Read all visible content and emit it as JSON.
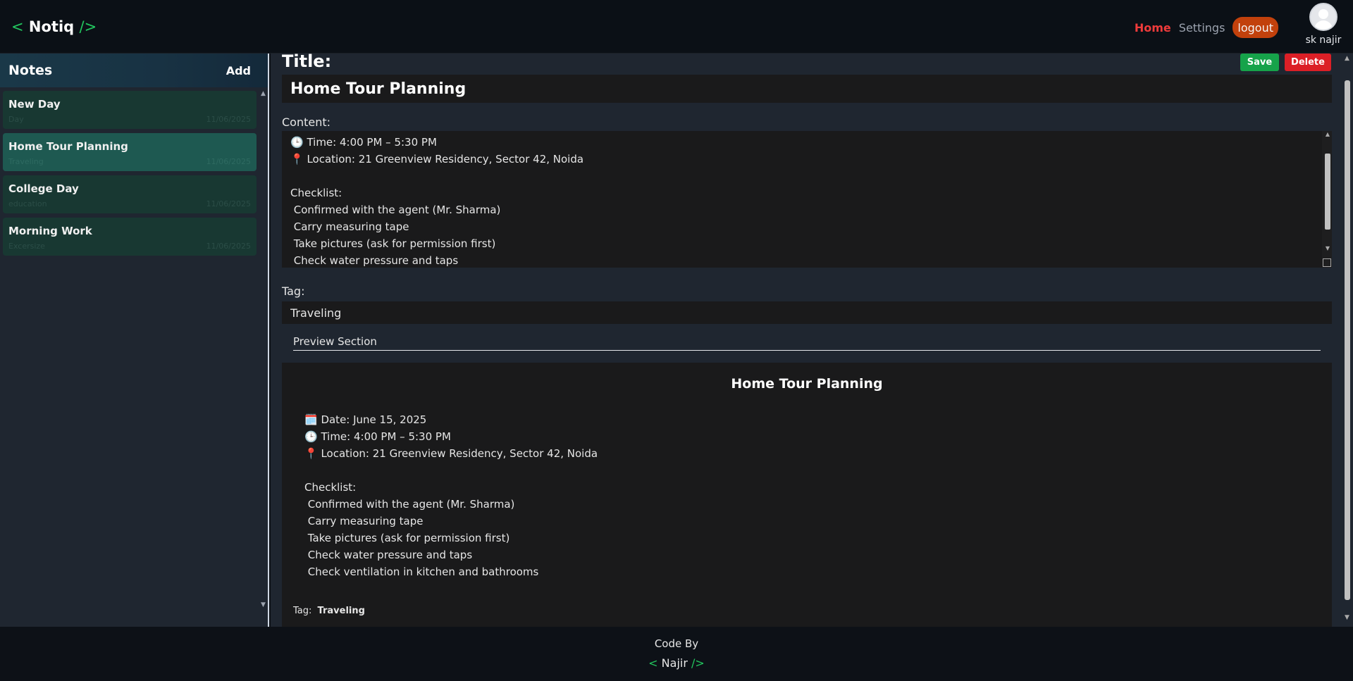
{
  "header": {
    "logo_open": "<",
    "logo_text": "Notiq",
    "logo_close": "/>",
    "nav_home": "Home",
    "nav_settings": "Settings",
    "logout_label": "logout",
    "user_name": "sk najir"
  },
  "sidebar": {
    "title": "Notes",
    "add_label": "Add",
    "notes": [
      {
        "title": "New Day",
        "tag": "Day",
        "date": "11/06/2025"
      },
      {
        "title": "Home Tour Planning",
        "tag": "Traveling",
        "date": "11/06/2025"
      },
      {
        "title": "College Day",
        "tag": "education",
        "date": "11/06/2025"
      },
      {
        "title": "Morning Work",
        "tag": "Excersize",
        "date": "11/06/2025"
      }
    ]
  },
  "editor": {
    "title_label": "Title:",
    "save_label": "Save",
    "delete_label": "Delete",
    "title_value": "Home Tour Planning",
    "content_label": "Content:",
    "content_lines": [
      "🕒 Time: 4:00 PM – 5:30 PM",
      "📍 Location: 21 Greenview Residency, Sector 42, Noida",
      "",
      "Checklist:",
      " Confirmed with the agent (Mr. Sharma)",
      " Carry measuring tape",
      " Take pictures (ask for permission first)",
      " Check water pressure and taps"
    ],
    "tag_label": "Tag:",
    "tag_value": "Traveling"
  },
  "preview": {
    "heading": "Preview Section",
    "title": "Home Tour Planning",
    "lines": [
      "🗓️ Date: June 15, 2025",
      "🕒 Time: 4:00 PM – 5:30 PM",
      "📍 Location: 21 Greenview Residency, Sector 42, Noida",
      "",
      "Checklist:",
      " Confirmed with the agent (Mr. Sharma)",
      " Carry measuring tape",
      " Take pictures (ask for permission first)",
      " Check water pressure and taps",
      " Check ventilation in kitchen and bathrooms"
    ],
    "tag_label": "Tag:",
    "tag_value": "Traveling"
  },
  "footer": {
    "line1": "Code By",
    "open": "<",
    "name": "Najir",
    "close": "/>"
  },
  "icons": {
    "avatar": "user-avatar-icon",
    "scroll": "scroll-arrow-icon"
  },
  "colors": {
    "accent_green": "#22c55e",
    "home_red": "#ef3b3b",
    "logout_orange": "#c2410c",
    "save_green": "#16a34a",
    "delete_red": "#dc1f26"
  }
}
